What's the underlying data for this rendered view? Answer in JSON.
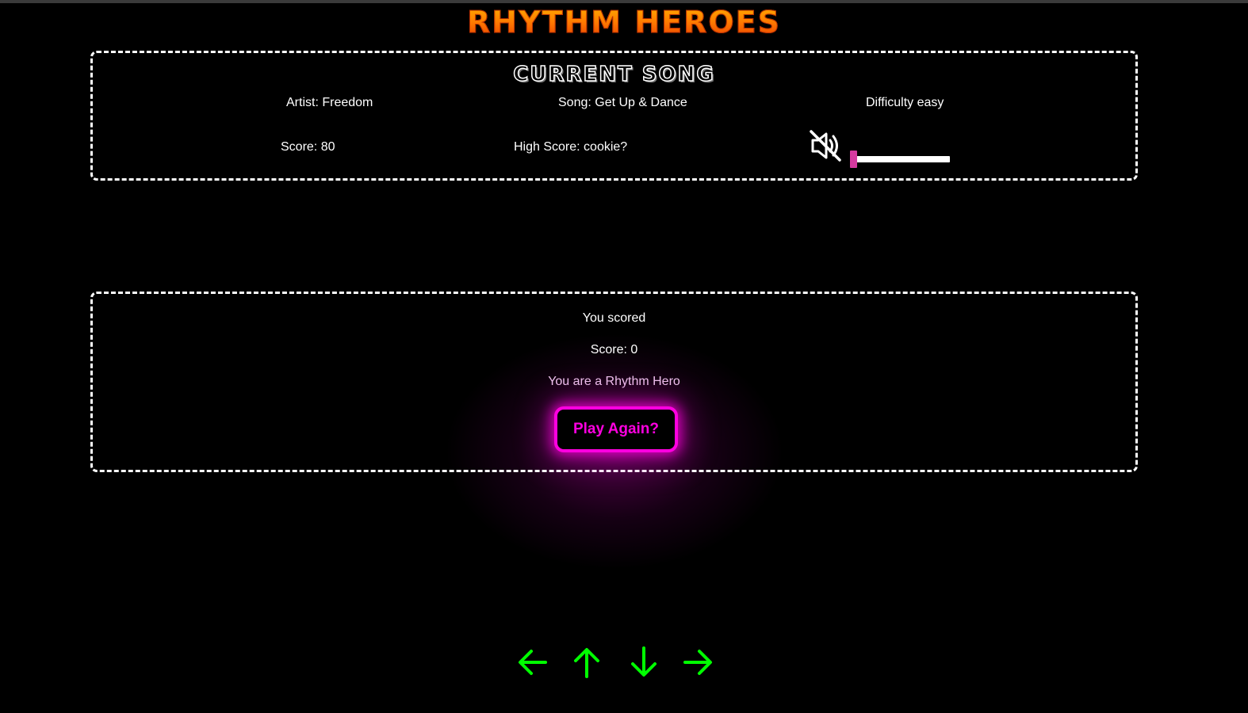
{
  "header": {
    "title": "RHYTHM HEROES"
  },
  "song_panel": {
    "heading": "CURRENT SONG",
    "artist": "Artist: Freedom",
    "song": "Song: Get Up & Dance",
    "difficulty": "Difficulty easy",
    "score": "Score: 80",
    "high_score": "High Score: cookie?",
    "volume": {
      "muted": true,
      "level": 0.0,
      "accent_color": "#d63aa0",
      "icon": "speaker-muted-icon"
    }
  },
  "result_panel": {
    "line1": "You scored",
    "score": "Score: 0",
    "rank": "You are a Rhythm Hero",
    "play_again_label": "Play Again?",
    "accent_color": "#ff00e0"
  },
  "controls": {
    "arrow_color": "#00ff00",
    "arrows": [
      "left-arrow-icon",
      "up-arrow-icon",
      "down-arrow-icon",
      "right-arrow-icon"
    ]
  }
}
